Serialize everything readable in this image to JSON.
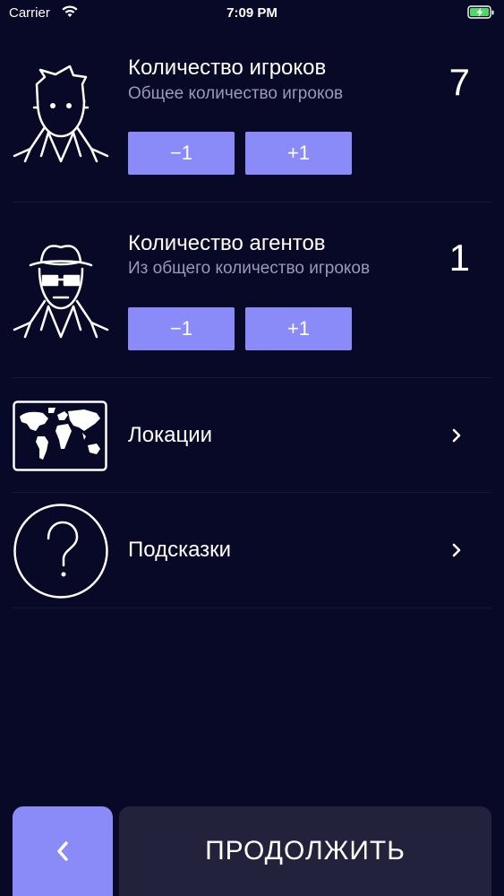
{
  "status_bar": {
    "carrier": "Carrier",
    "time": "7:09 PM"
  },
  "players": {
    "title": "Количество игроков",
    "subtitle": "Общее количество игроков",
    "count": "7",
    "decrement_label": "−1",
    "increment_label": "+1",
    "icon": "player-icon"
  },
  "agents": {
    "title": "Количество агентов",
    "subtitle": "Из общего количество игроков",
    "count": "1",
    "decrement_label": "−1",
    "increment_label": "+1",
    "icon": "spy-agent-icon"
  },
  "menu": {
    "locations_label": "Локации",
    "locations_icon": "world-map-icon",
    "hints_label": "Подсказки",
    "hints_icon": "question-icon"
  },
  "footer": {
    "continue_label": "ПРОДОЛЖИТЬ",
    "back_icon": "chevron-left-icon"
  },
  "colors": {
    "background": "#080827",
    "accent": "#8a8af8",
    "secondary_button": "#22223c",
    "subtitle_text": "#9a9ab6"
  }
}
